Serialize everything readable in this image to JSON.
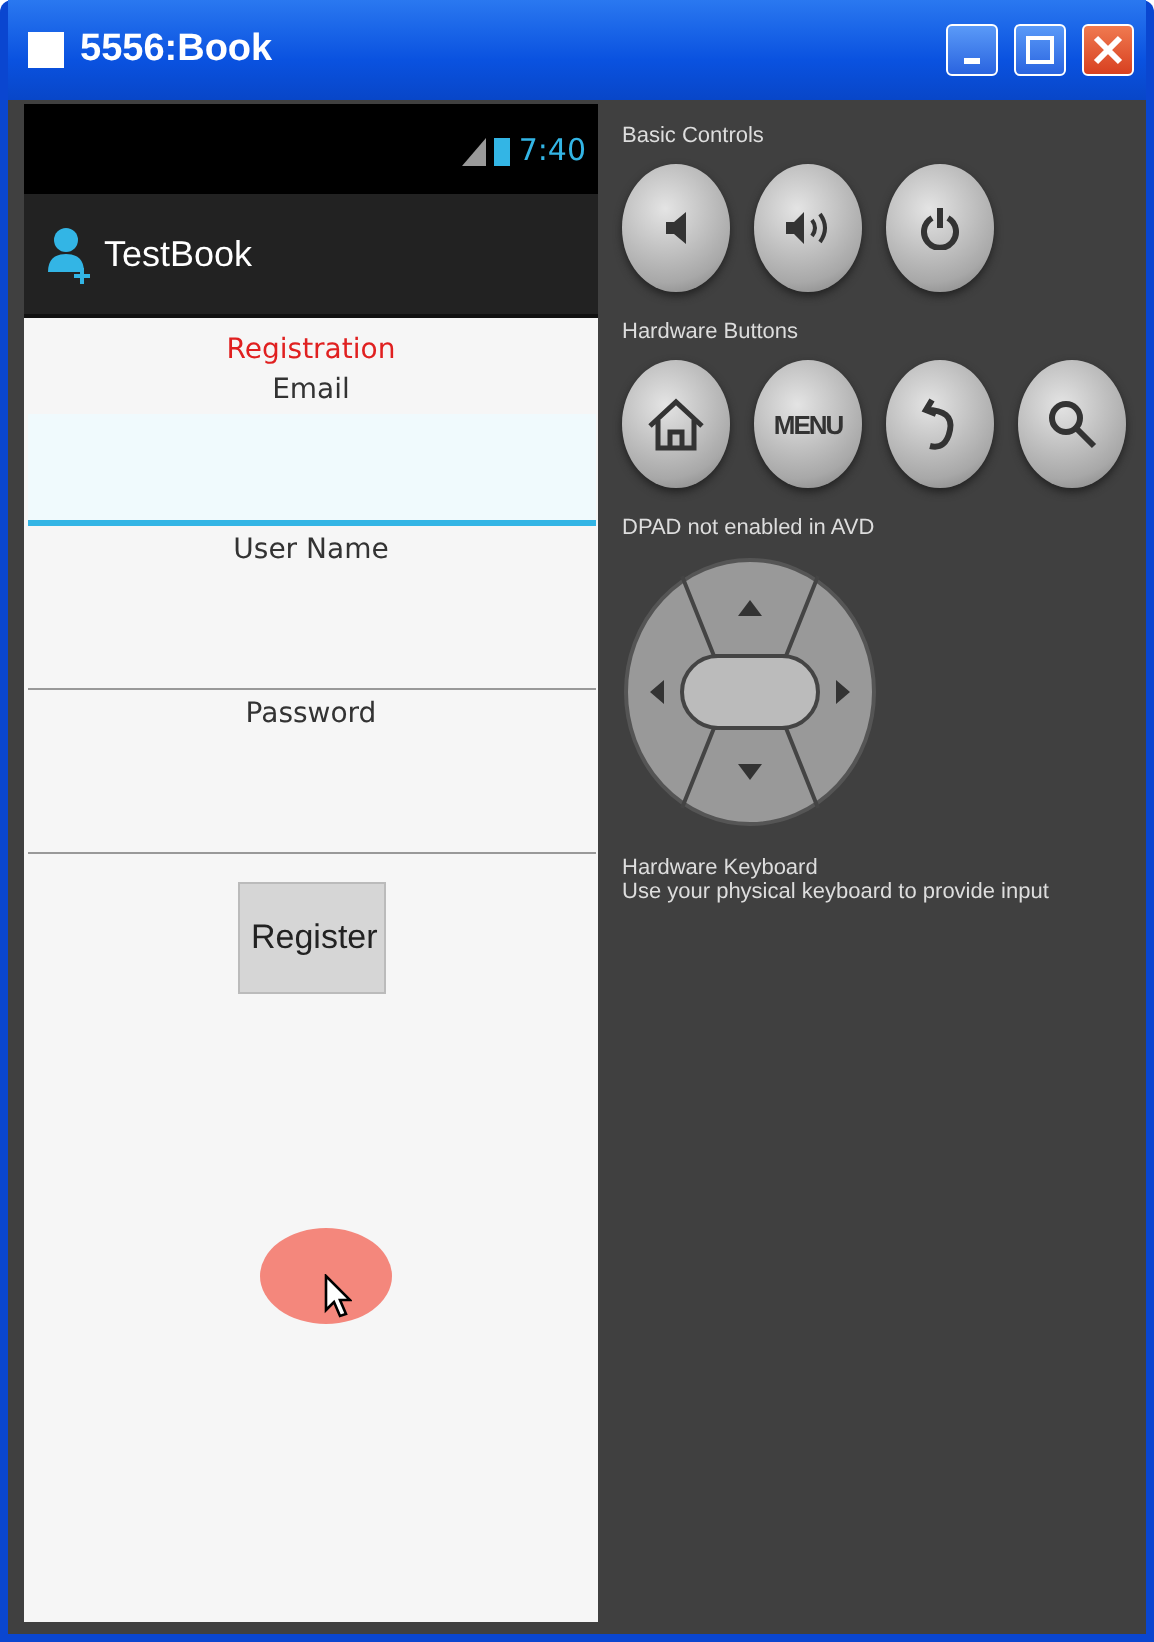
{
  "window": {
    "title": "5556:Book"
  },
  "status_bar": {
    "time": "7:40"
  },
  "action_bar": {
    "title": "TestBook"
  },
  "form": {
    "heading": "Registration",
    "fields": [
      {
        "label": "Email",
        "focused": true
      },
      {
        "label": "User Name",
        "focused": false
      },
      {
        "label": "Password",
        "focused": false
      }
    ],
    "button": "Register"
  },
  "controls": {
    "sections": [
      {
        "title": "Basic Controls",
        "buttons": [
          {
            "kind": "volume-down"
          },
          {
            "kind": "volume-up"
          },
          {
            "kind": "power"
          }
        ]
      },
      {
        "title": "Hardware Buttons",
        "buttons": [
          {
            "kind": "home"
          },
          {
            "kind": "text",
            "label": "MENU"
          },
          {
            "kind": "back"
          },
          {
            "kind": "search"
          }
        ]
      }
    ],
    "dpad_title": "DPAD not enabled in AVD",
    "keyboard": {
      "title": "Hardware Keyboard",
      "hint": "Use your physical keyboard to provide input"
    }
  }
}
